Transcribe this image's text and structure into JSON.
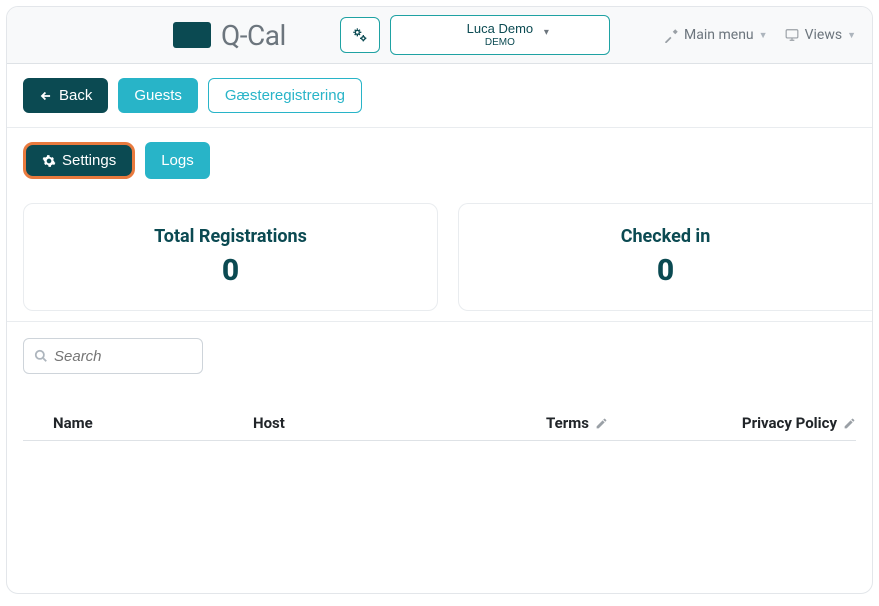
{
  "header": {
    "brand": "Q-Cal",
    "tenant_name": "Luca Demo",
    "tenant_sub": "DEMO",
    "main_menu": "Main menu",
    "views": "Views"
  },
  "nav": {
    "back": "Back",
    "guests": "Guests",
    "guest_reg": "Gæsteregistrering"
  },
  "tabs": {
    "settings": "Settings",
    "logs": "Logs"
  },
  "stats": {
    "total_label": "Total Registrations",
    "total_value": "0",
    "checked_label": "Checked in",
    "checked_value": "0"
  },
  "table": {
    "search_placeholder": "Search",
    "cols": {
      "name": "Name",
      "host": "Host",
      "terms": "Terms",
      "privacy": "Privacy Policy"
    }
  }
}
